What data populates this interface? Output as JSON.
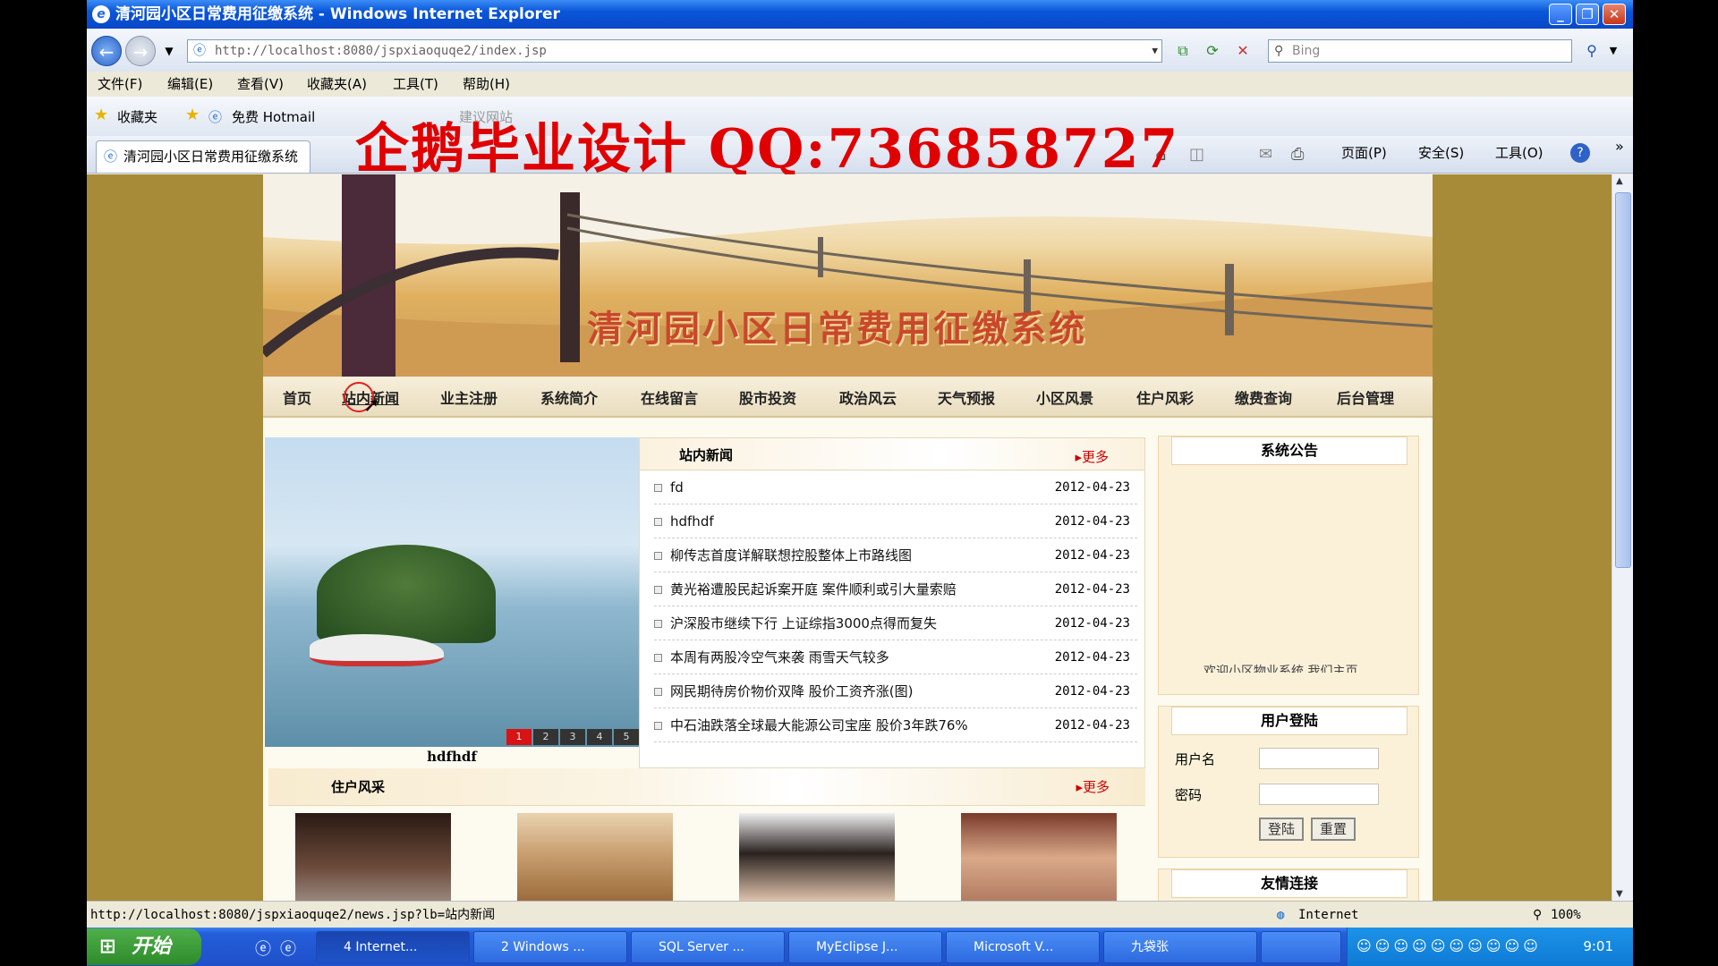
{
  "window": {
    "title": "清河园小区日常费用征缴系统 - Windows Internet Explorer",
    "url": "http://localhost:8080/jspxiaoquqe2/index.jsp",
    "search_placeholder": "Bing"
  },
  "menu": [
    "文件(F)",
    "编辑(E)",
    "查看(V)",
    "收藏夹(A)",
    "工具(T)",
    "帮助(H)"
  ],
  "favbar": {
    "favorites": "收藏夹",
    "hotmail": "免费 Hotmail",
    "suggested": "建议网站"
  },
  "tab": {
    "label": "清河园小区日常费用征缴系统"
  },
  "watermark": "企鹅毕业设计  QQ:736858727",
  "commandbar": {
    "page": "页面(P)",
    "safety": "安全(S)",
    "tools": "工具(O)"
  },
  "site": {
    "title": "清河园小区日常费用征缴系统",
    "nav": [
      "首页",
      "站内新闻",
      "业主注册",
      "系统简介",
      "在线留言",
      "股市投资",
      "政治风云",
      "天气预报",
      "小区风景",
      "住户风彩",
      "缴费查询",
      "后台管理"
    ]
  },
  "slideshow": {
    "caption": "hdfhdf",
    "pages": [
      "1",
      "2",
      "3",
      "4",
      "5"
    ],
    "active": 0
  },
  "news": {
    "title": "站内新闻",
    "more": "更多",
    "items": [
      {
        "title": "fd",
        "date": "2012-04-23"
      },
      {
        "title": "hdfhdf",
        "date": "2012-04-23"
      },
      {
        "title": "柳传志首度详解联想控股整体上市路线图",
        "date": "2012-04-23"
      },
      {
        "title": "黄光裕遭股民起诉案开庭 案件顺利或引大量索赔",
        "date": "2012-04-23"
      },
      {
        "title": "沪深股市继续下行 上证综指3000点得而复失",
        "date": "2012-04-23"
      },
      {
        "title": "本周有两股冷空气来袭 雨雪天气较多",
        "date": "2012-04-23"
      },
      {
        "title": "网民期待房价物价双降 股价工资齐涨(图)",
        "date": "2012-04-23"
      },
      {
        "title": "中石油跌落全球最大能源公司宝座 股价3年跌76%",
        "date": "2012-04-23"
      }
    ]
  },
  "residents": {
    "title": "住户风采",
    "more": "更多"
  },
  "sidebar": {
    "notice_title": "系统公告",
    "notice_text": "欢迎小区物业系统 我们主页",
    "login_title": "用户登陆",
    "username_label": "用户名",
    "password_label": "密码",
    "login_button": "登陆",
    "reset_button": "重置",
    "links_title": "友情连接"
  },
  "statusbar": {
    "url": "http://localhost:8080/jspxiaoquqe2/news.jsp?lb=站内新闻",
    "zone": "Internet",
    "zoom": "100%"
  },
  "taskbar": {
    "start": "开始",
    "tasks": [
      "4 Internet...",
      "2 Windows ...",
      "SQL Server ...",
      "MyEclipse J...",
      "Microsoft V...",
      "九袋张"
    ],
    "clock": "9:01"
  },
  "colors": {
    "accent_red": "#c8482a",
    "page_bg": "#a78b38",
    "xp_blue": "#245edb"
  }
}
